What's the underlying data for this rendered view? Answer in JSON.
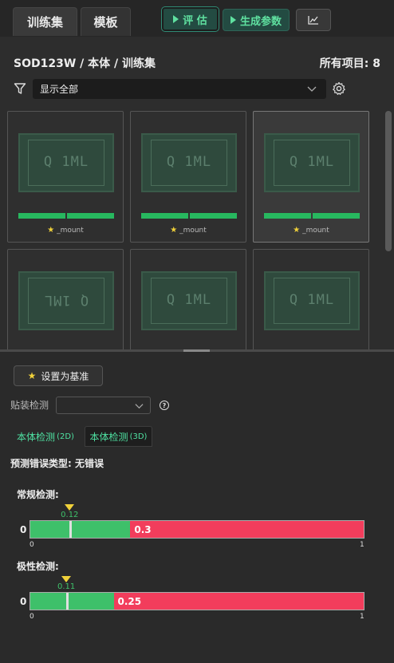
{
  "tabs": [
    {
      "label": "训练集",
      "active": true
    },
    {
      "label": "模板",
      "active": false
    }
  ],
  "toolbar": {
    "evaluate_label": "评 估",
    "generate_label": "生成参数",
    "chart_icon": "chart-line-icon"
  },
  "breadcrumb": "SOD123W / 本体 / 训练集",
  "item_count": "所有项目:  8",
  "filter": {
    "icon": "funnel-icon",
    "selected": "显示全部",
    "settings_icon": "gear-icon"
  },
  "cards": [
    {
      "marking": "Q 1ML",
      "flipped": false,
      "tag": "_mount",
      "selected": false
    },
    {
      "marking": "Q 1ML",
      "flipped": false,
      "tag": "_mount",
      "selected": false
    },
    {
      "marking": "Q 1ML",
      "flipped": false,
      "tag": "_mount",
      "selected": true
    },
    {
      "marking": "Q 1ML",
      "flipped": true,
      "tag": "",
      "selected": false
    },
    {
      "marking": "Q 1ML",
      "flipped": false,
      "tag": "",
      "selected": false
    },
    {
      "marking": "Q 1ML",
      "flipped": false,
      "tag": "",
      "selected": false
    }
  ],
  "panel": {
    "set_baseline_label": "设置为基准",
    "mount_check_label": "贴装检测",
    "mount_check_value": "",
    "subtabs": [
      {
        "label": "本体检测",
        "suffix": "(2D)",
        "active": true
      },
      {
        "label": "本体检测",
        "suffix": "(3D)",
        "active": false
      }
    ],
    "prediction": "预测错误类型: 无错误"
  },
  "gauges": [
    {
      "label": "常规检测:",
      "threshold": 0.3,
      "threshold_label": "0.3",
      "current": 0.12,
      "current_label": "0.12",
      "min_label": "0",
      "max_label": "1",
      "zero_label": "0"
    },
    {
      "label": "极性检测:",
      "threshold": 0.25,
      "threshold_label": "0.25",
      "current": 0.11,
      "current_label": "0.11",
      "min_label": "0",
      "max_label": "1",
      "zero_label": "0"
    }
  ],
  "colors": {
    "pass": "#3ec06a",
    "fail": "#f23d5c",
    "accent": "#5fe0a0",
    "star": "#f0d13a"
  }
}
